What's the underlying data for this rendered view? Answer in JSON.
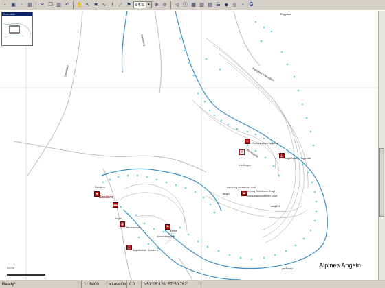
{
  "toolbar": {
    "zoom_value": "84 ts",
    "buttons": [
      "new-icon",
      "open-icon",
      "save-icon",
      "print-icon",
      "cut-icon",
      "copy-icon",
      "paste-icon",
      "undo-icon",
      "hand-icon",
      "pointer-icon",
      "waypoint-icon",
      "route-icon",
      "track-icon",
      "ruler-icon",
      "zoom-in-icon",
      "zoom-out-icon",
      "back-icon",
      "info-icon",
      "grid-icon",
      "layer-icon",
      "search-icon",
      "g-icon"
    ]
  },
  "overview": {
    "title": "Overview"
  },
  "map": {
    "labels": [
      {
        "text": "Engpass",
        "name": "label-engpass"
      },
      {
        "text": "Steinkarp",
        "name": "label-steinkarp"
      },
      {
        "text": "Kleinberg",
        "name": "label-kleinberg"
      },
      {
        "text": "Parkplatz Oberalpen",
        "name": "label-parkplatz"
      },
      {
        "text": "Schutzhütte Hagental",
        "name": "label-schutzhuette"
      },
      {
        "text": "Angelfahrer Hagental",
        "name": "label-angelfahrer"
      },
      {
        "text": "Bootsstelle",
        "name": "label-bootsstelle"
      },
      {
        "text": "Lintlingen",
        "name": "label-lintlingen"
      },
      {
        "text": "camping sonderner kopf",
        "name": "label-camping1"
      },
      {
        "text": "camping Sonderner Kopf",
        "name": "label-camping2"
      },
      {
        "text": "camping sonderner kopf",
        "name": "label-camping3"
      },
      {
        "text": "wegl2",
        "name": "label-weg12"
      },
      {
        "text": "weg111",
        "name": "label-weg111"
      },
      {
        "text": "Sondern",
        "name": "label-sondern-small"
      },
      {
        "text": "Sondern",
        "name": "label-sondern"
      },
      {
        "text": "kajak",
        "name": "label-kajak"
      },
      {
        "text": "Tauchschule",
        "name": "label-tauchschule"
      },
      {
        "text": "Hebe",
        "name": "label-hebe"
      },
      {
        "text": "Angelfahrer Sondern",
        "name": "label-angelfahrer-sondern"
      },
      {
        "text": "parkplatz",
        "name": "label-parkplatz-small"
      },
      {
        "text": "Aussichtspunkt",
        "name": "label-aussichtspunkt"
      }
    ],
    "scale_label": "500 m"
  },
  "watermark": "Alpines Angeln",
  "status": {
    "ready": "Ready*",
    "scale": "1 : 8400",
    "level": "<Level0>",
    "value": "0.0",
    "coords": "N51°05.126' E7°50.762'"
  }
}
